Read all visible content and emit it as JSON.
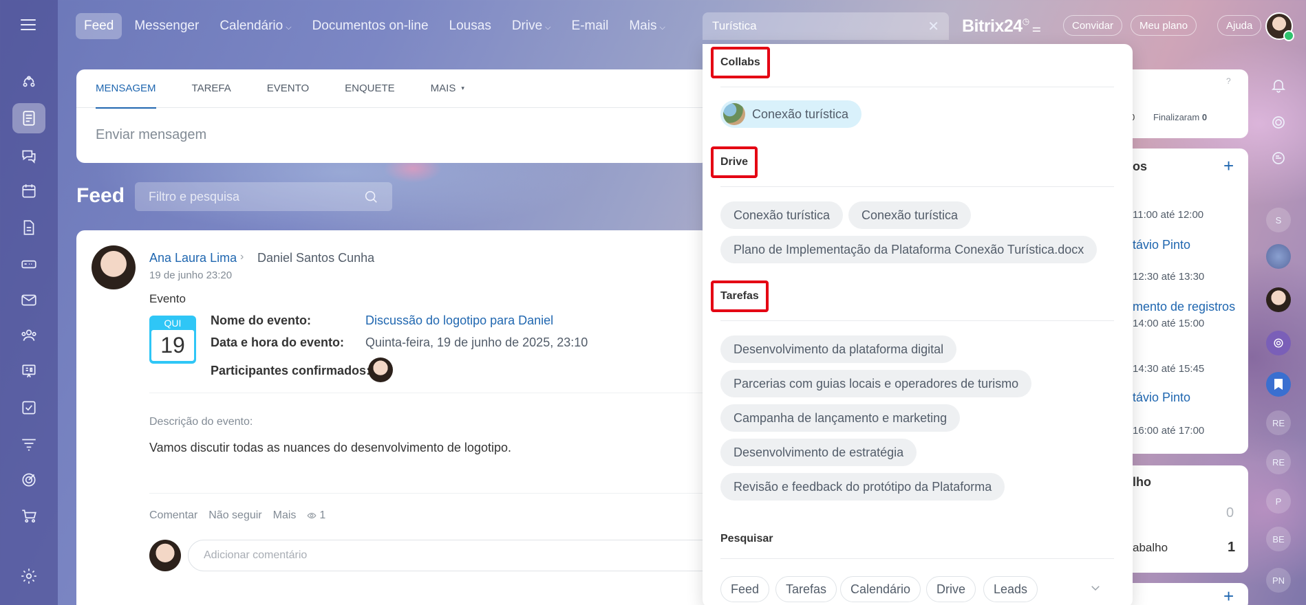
{
  "topnav": {
    "items": [
      {
        "label": "Feed",
        "active": true
      },
      {
        "label": "Messenger"
      },
      {
        "label": "Calendário",
        "caret": true
      },
      {
        "label": "Documentos on-line"
      },
      {
        "label": "Lousas"
      },
      {
        "label": "Drive",
        "caret": true
      },
      {
        "label": "E-mail"
      },
      {
        "label": "Mais",
        "caret": true
      }
    ],
    "search_value": "Turística",
    "brand": "Bitrix",
    "brand_num": "24",
    "invite": "Convidar",
    "plan": "Meu plano",
    "help": "Ajuda"
  },
  "left_rail_icons": [
    "menu-icon",
    "collab-icon",
    "feed-icon",
    "chat-icon",
    "calendar-icon",
    "document-icon",
    "drive-icon",
    "mail-icon",
    "people-icon",
    "board-icon",
    "tasks-icon",
    "filter-icon",
    "target-icon",
    "cart-icon",
    "settings-icon"
  ],
  "composer": {
    "tabs": [
      "MENSAGEM",
      "TAREFA",
      "EVENTO",
      "ENQUETE",
      "MAIS"
    ],
    "placeholder": "Enviar mensagem"
  },
  "feed": {
    "title": "Feed",
    "filter_placeholder": "Filtro e pesquisa"
  },
  "post": {
    "author": "Ana Laura Lima",
    "recipient": "Daniel Santos Cunha",
    "date": "19 de junho 23:20",
    "type": "Evento",
    "calendar_dow": "QUI",
    "calendar_day": "19",
    "event_name_label": "Nome do evento:",
    "event_name": "Discussão do logotipo para Daniel",
    "event_datetime_label": "Data e hora do evento:",
    "event_datetime": "Quinta-feira, 19 de junho de 2025, 23:10",
    "participants_label": "Participantes confirmados:",
    "description_label": "Descrição do evento:",
    "description": "Vamos discutir todas as nuances do desenvolvimento de logotipo.",
    "actions": [
      "Comentar",
      "Não seguir",
      "Mais"
    ],
    "views": "1",
    "comment_placeholder": "Adicionar comentário"
  },
  "right_widgets": {
    "stats_text_1": "0",
    "stats_label": "Finalizaram",
    "stats_value": "0",
    "section_suffix": "os",
    "times": [
      "11:00 até 12:00",
      "12:30 até 13:30",
      "14:00 até 15:00",
      "14:30 até 15:45",
      "16:00 até 17:00"
    ],
    "links": [
      "távio Pinto",
      "mento de registros",
      "távio Pinto"
    ],
    "work_title": "lho",
    "work_value_1": "0",
    "work_label": "abalho",
    "work_value_2": "1"
  },
  "right_rail": [
    "S",
    "RE",
    "RE",
    "P",
    "BE",
    "PN"
  ],
  "dropdown": {
    "collabs_title": "Collabs",
    "collabs": [
      "Conexão turística"
    ],
    "drive_title": "Drive",
    "drive": [
      "Conexão turística",
      "Conexão turística",
      "Plano de Implementação da Plataforma Conexão Turística.docx"
    ],
    "tasks_title": "Tarefas",
    "tasks": [
      "Desenvolvimento da plataforma digital",
      "Parcerias com guias locais e operadores de turismo",
      "Campanha de lançamento e marketing",
      "Desenvolvimento de estratégia",
      "Revisão e feedback do protótipo da Plataforma"
    ],
    "search_title": "Pesquisar",
    "search_filters": [
      "Feed",
      "Tarefas",
      "Calendário",
      "Drive",
      "Leads"
    ]
  },
  "colors": {
    "accent": "#2067b0",
    "highlight_box": "#e40013",
    "calendar": "#2fc6f6"
  }
}
